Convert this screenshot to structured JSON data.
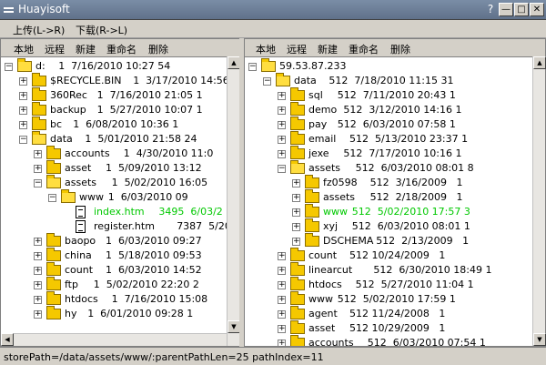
{
  "window": {
    "title": "Huayisoft",
    "help_glyph": "?",
    "min_glyph": "—",
    "max_glyph": "□",
    "close_glyph": "✕"
  },
  "menu": {
    "upload": "上传(L->R)",
    "download": "下载(R->L)"
  },
  "toolbar": {
    "local": "本地",
    "remote": "远程",
    "new": "新建",
    "rename": "重命名",
    "delete": "删除"
  },
  "left_tree": [
    {
      "level": 0,
      "name": "d:",
      "info": "1  7/16/2010 10:27 54",
      "type": "folder",
      "open": true
    },
    {
      "level": 1,
      "name": "$RECYCLE.BIN",
      "info": "1  3/17/2010 14:56",
      "type": "folder"
    },
    {
      "level": 1,
      "name": "360Rec",
      "info": "1  7/16/2010 21:05 1",
      "type": "folder"
    },
    {
      "level": 1,
      "name": "backup",
      "info": "1  5/27/2010 10:07 1",
      "type": "folder"
    },
    {
      "level": 1,
      "name": "bc",
      "info": "1  6/08/2010 10:36 1",
      "type": "folder"
    },
    {
      "level": 1,
      "name": "data",
      "info": "1  5/01/2010 21:58 24",
      "type": "folder",
      "open": true
    },
    {
      "level": 2,
      "name": "accounts",
      "info": "1  4/30/2010 11:0",
      "type": "folder"
    },
    {
      "level": 2,
      "name": "asset",
      "info": "1  5/09/2010 13:12",
      "type": "folder"
    },
    {
      "level": 2,
      "name": "assets",
      "info": "1  5/02/2010 16:05",
      "type": "folder",
      "open": true
    },
    {
      "level": 3,
      "name": "www",
      "info": "1  6/03/2010 09",
      "type": "folder",
      "open": true
    },
    {
      "level": 4,
      "name": "index.htm",
      "info": "3495  6/03/2",
      "type": "file",
      "highlight": true
    },
    {
      "level": 4,
      "name": "register.htm",
      "info": "7387  5/20/",
      "type": "file"
    },
    {
      "level": 2,
      "name": "baopo",
      "info": "1  6/03/2010 09:27",
      "type": "folder"
    },
    {
      "level": 2,
      "name": "china",
      "info": "1  5/18/2010 09:53",
      "type": "folder"
    },
    {
      "level": 2,
      "name": "count",
      "info": "1  6/03/2010 14:52",
      "type": "folder"
    },
    {
      "level": 2,
      "name": "ftp",
      "info": "1  5/02/2010 22:20 2",
      "type": "folder"
    },
    {
      "level": 2,
      "name": "htdocs",
      "info": "1  7/16/2010 15:08",
      "type": "folder"
    },
    {
      "level": 2,
      "name": "hy",
      "info": "1  6/01/2010 09:28 1",
      "type": "folder"
    }
  ],
  "right_tree": [
    {
      "level": 0,
      "name": "59.53.87.233",
      "info": "",
      "type": "folder",
      "open": true
    },
    {
      "level": 1,
      "name": "data",
      "info": "512  7/18/2010 11:15 31",
      "type": "folder",
      "open": true
    },
    {
      "level": 2,
      "name": "sql",
      "info": "512  7/11/2010 20:43 1",
      "type": "folder"
    },
    {
      "level": 2,
      "name": "demo",
      "info": "512  3/12/2010 14:16 1",
      "type": "folder"
    },
    {
      "level": 2,
      "name": "pay",
      "info": "512  6/03/2010 07:58 1",
      "type": "folder"
    },
    {
      "level": 2,
      "name": "email",
      "info": "512  5/13/2010 23:37 1",
      "type": "folder"
    },
    {
      "level": 2,
      "name": "jexe",
      "info": "512  7/17/2010 10:16 1",
      "type": "folder"
    },
    {
      "level": 2,
      "name": "assets",
      "info": "512  6/03/2010 08:01 8",
      "type": "folder",
      "open": true
    },
    {
      "level": 3,
      "name": "fz0598",
      "info": "512  3/16/2009   1",
      "type": "folder"
    },
    {
      "level": 3,
      "name": "assets",
      "info": "512  2/18/2009   1",
      "type": "folder"
    },
    {
      "level": 3,
      "name": "www",
      "info": "512  5/02/2010 17:57 3",
      "type": "folder",
      "highlight": true
    },
    {
      "level": 3,
      "name": "xyj",
      "info": "512  6/03/2010 08:01 1",
      "type": "folder"
    },
    {
      "level": 3,
      "name": "DSCHEMA",
      "info": "512  2/13/2009   1",
      "type": "folder"
    },
    {
      "level": 2,
      "name": "count",
      "info": "512 10/24/2009   1",
      "type": "folder"
    },
    {
      "level": 2,
      "name": "linearcut",
      "info": "512  6/30/2010 18:49 1",
      "type": "folder"
    },
    {
      "level": 2,
      "name": "htdocs",
      "info": "512  5/27/2010 11:04 1",
      "type": "folder"
    },
    {
      "level": 2,
      "name": "www",
      "info": "512  5/02/2010 17:59 1",
      "type": "folder"
    },
    {
      "level": 2,
      "name": "agent",
      "info": "512 11/24/2008   1",
      "type": "folder"
    },
    {
      "level": 2,
      "name": "asset",
      "info": "512 10/29/2009   1",
      "type": "folder"
    },
    {
      "level": 2,
      "name": "accounts",
      "info": "512  6/03/2010 07:54 1",
      "type": "folder"
    }
  ],
  "status": {
    "text": "storePath=/data/assets/www/:parentPathLen=25 pathIndex=11"
  },
  "colors": {
    "highlight": "#00c800",
    "folder": "#f5c800",
    "titlebar": "#6c7e97"
  }
}
